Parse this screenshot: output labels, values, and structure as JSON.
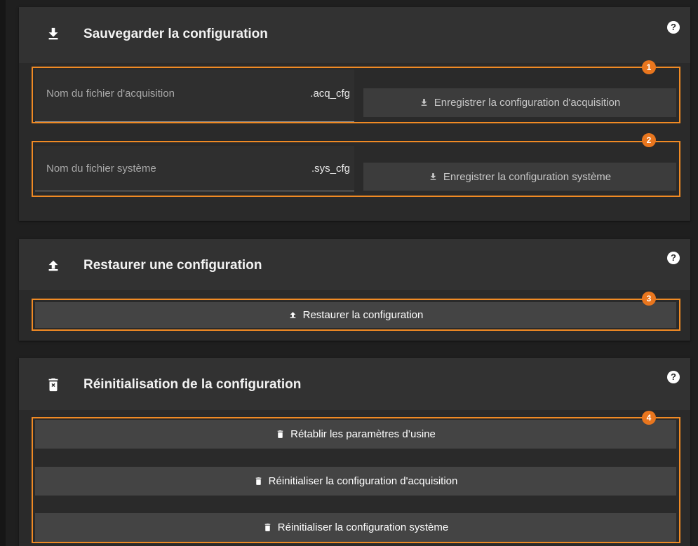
{
  "save_panel": {
    "title": "Sauvegarder la configuration",
    "header_icon": "download-icon",
    "help": "?",
    "acquisition": {
      "placeholder": "Nom du fichier d'acquisition",
      "suffix": ".acq_cfg",
      "button_label": "Enregistrer la configuration d'acquisition",
      "button_icon": "download-icon",
      "marker": "1"
    },
    "system": {
      "placeholder": "Nom du fichier système",
      "suffix": ".sys_cfg",
      "button_label": "Enregistrer la configuration système",
      "button_icon": "download-icon",
      "marker": "2"
    }
  },
  "restore_panel": {
    "title": "Restaurer une configuration",
    "header_icon": "upload-icon",
    "help": "?",
    "button_label": "Restaurer la configuration",
    "button_icon": "upload-icon",
    "marker": "3"
  },
  "reset_panel": {
    "title": "Réinitialisation de la configuration",
    "header_icon": "delete-box-icon",
    "help": "?",
    "marker": "4",
    "buttons": [
      {
        "label": "Rétablir les paramètres d’usine",
        "icon": "delete-box-icon"
      },
      {
        "label": "Réinitialiser la configuration d'acquisition",
        "icon": "delete-box-icon"
      },
      {
        "label": "Réinitialiser la configuration système",
        "icon": "delete-box-icon"
      }
    ]
  },
  "colors": {
    "background": "#1f1f1f",
    "panel": "#2a2a2a",
    "panel_header": "#323232",
    "button": "#444444",
    "highlight": "#f08a24"
  }
}
